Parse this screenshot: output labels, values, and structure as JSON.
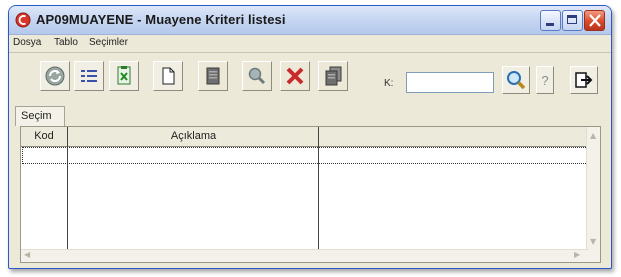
{
  "window": {
    "title": "AP09MUAYENE - Muayene Kriteri listesi"
  },
  "titlebar_buttons": {
    "minimize_icon": "minimize-icon",
    "maximize_icon": "maximize-icon",
    "close_icon": "close-icon"
  },
  "menu": {
    "items": [
      {
        "label": "Dosya"
      },
      {
        "label": "Tablo"
      },
      {
        "label": "Seçimler"
      }
    ]
  },
  "toolbar": {
    "buttons": [
      {
        "icon": "refresh-icon",
        "enabled": true
      },
      {
        "icon": "list-icon",
        "enabled": true
      },
      {
        "icon": "excel-export-icon",
        "enabled": true
      },
      {
        "icon": "new-document-icon",
        "enabled": true
      },
      {
        "icon": "edit-document-icon",
        "enabled": false
      },
      {
        "icon": "magnifier-icon",
        "enabled": false
      },
      {
        "icon": "delete-icon",
        "enabled": false
      },
      {
        "icon": "copy-icon",
        "enabled": false
      }
    ],
    "k_label": "K:",
    "k_value": "",
    "right_buttons": [
      {
        "icon": "search-icon"
      },
      {
        "icon": "help-icon",
        "text": "?"
      },
      {
        "icon": "exit-icon"
      }
    ]
  },
  "tabs": {
    "secim": "Seçim"
  },
  "grid": {
    "columns": [
      "Kod",
      "Açıklama",
      ""
    ],
    "rows": []
  },
  "colors": {
    "titlebar": "#c9d8f2",
    "close_button": "#d94a2a",
    "window_border": "#2b58c9",
    "face": "#ece9d8"
  }
}
